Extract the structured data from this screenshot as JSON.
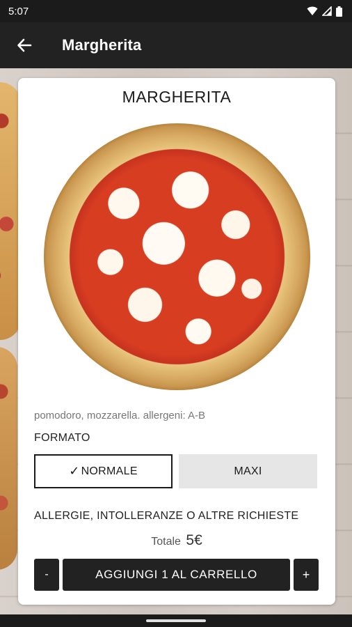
{
  "status_bar": {
    "time": "5:07",
    "icons": [
      "wifi-icon",
      "signal-icon",
      "battery-icon"
    ]
  },
  "app_bar": {
    "title": "Margherita",
    "back_icon": "arrow-left-icon"
  },
  "product": {
    "name": "MARGHERITA",
    "description": "pomodoro, mozzarella. allergeni: A-B",
    "format_label": "FORMATO",
    "formats": [
      {
        "label": "NORMALE",
        "selected": true
      },
      {
        "label": "MAXI",
        "selected": false
      }
    ],
    "requests_label": "ALLERGIE, INTOLLERANZE O ALTRE RICHIESTE",
    "total_label": "Totale",
    "total_value": "5€"
  },
  "actions": {
    "minus": "-",
    "add_to_cart": "AGGIUNGI 1 AL CARRELLO",
    "plus": "+"
  },
  "colors": {
    "primary_dark": "#222222",
    "card_bg": "#ffffff",
    "unselected_option": "#e6e6e6"
  }
}
